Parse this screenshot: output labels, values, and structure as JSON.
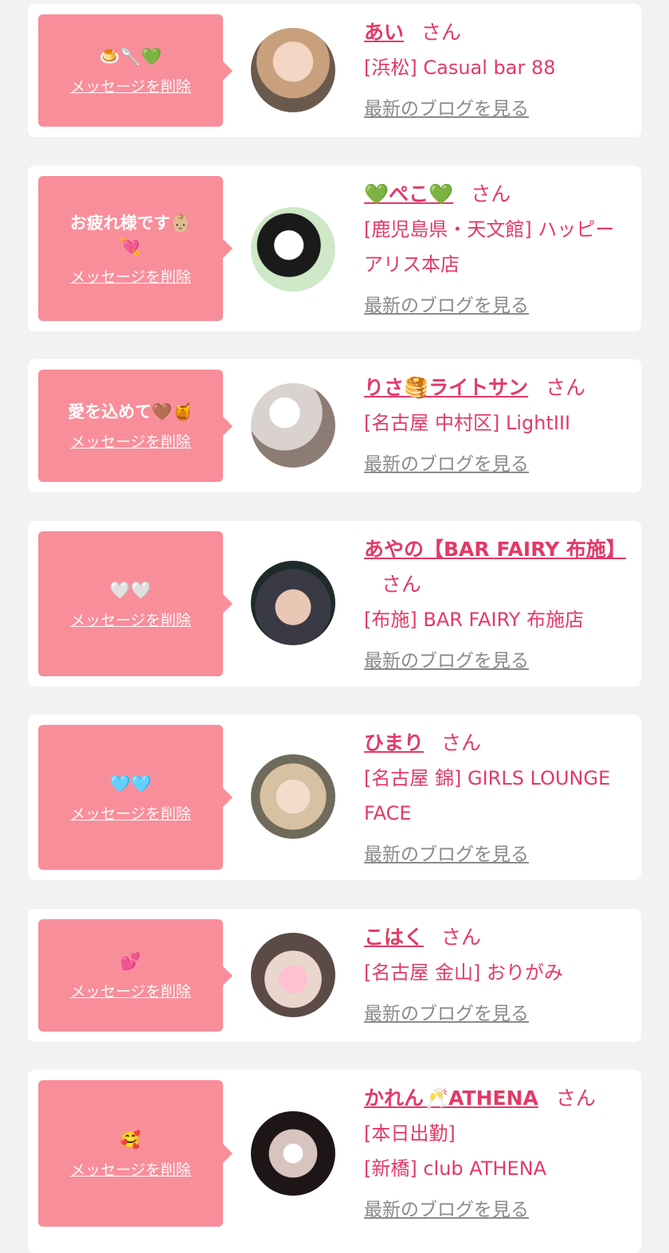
{
  "delete_label": "メッセージを削除",
  "blog_label": "最新のブログを見る",
  "san_label": "さん",
  "colors": {
    "bubble": "#f98e9b",
    "accent": "#e23a67",
    "muted": "#8a8a8a",
    "card": "#ffffff",
    "page": "#f2f2f2"
  },
  "items": [
    {
      "message": "🍮🥄💚",
      "name": "あい",
      "shop_lines": [
        "[浜松] Casual bar 88"
      ]
    },
    {
      "message": "お疲れ様です👶🏼\n💘",
      "name": "💚ぺこ💚",
      "shop_lines": [
        "[鹿児島県・天文館] ハッピーアリス本店"
      ]
    },
    {
      "message": "愛を込めて🤎🍯",
      "name": "りさ🥞ライトサン",
      "shop_lines": [
        "[名古屋 中村区] LightIII"
      ]
    },
    {
      "message": "🤍🤍",
      "name": "あやの【BAR FAIRY 布施】",
      "shop_lines": [
        "[布施] BAR FAIRY 布施店"
      ]
    },
    {
      "message": "🩵🩵",
      "name": "ひまり",
      "shop_lines": [
        "[名古屋 錦] GIRLS LOUNGE FACE"
      ]
    },
    {
      "message": "💕",
      "name": "こはく",
      "shop_lines": [
        "[名古屋 金山] おりがみ"
      ]
    },
    {
      "message": "🥰",
      "name": "かれん🥂ATHENA",
      "shop_lines": [
        "[本日出勤]",
        "[新橋] club ATHENA"
      ]
    }
  ]
}
